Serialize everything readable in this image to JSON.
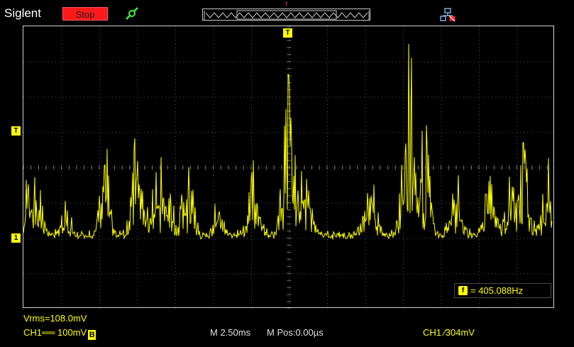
{
  "header": {
    "brand": "Siglent",
    "run_state": "Stop",
    "icons": [
      "probe-icon",
      "timebase-window-icon",
      "network-disconnected-icon"
    ],
    "trigger_top_marker": "T"
  },
  "markers": {
    "trigger_level": "T",
    "channel1_ground": "1",
    "trigger_position": "T"
  },
  "measurement": {
    "vrms": "Vrms=108.0mV",
    "frequency_icon": "f",
    "frequency": "= 405.088Hz"
  },
  "status": {
    "ch1": "CH1══ 100mV",
    "bandwidth_icon": "B",
    "timebase": "M 2.50ms",
    "mpos": "M Pos:0.00µs",
    "trigger": "CH1 ∕304mV"
  },
  "colors": {
    "trace": "#ffff00",
    "grid": "#555555",
    "stop_button": "#ff1a1a",
    "probe": "#44ee44"
  }
}
